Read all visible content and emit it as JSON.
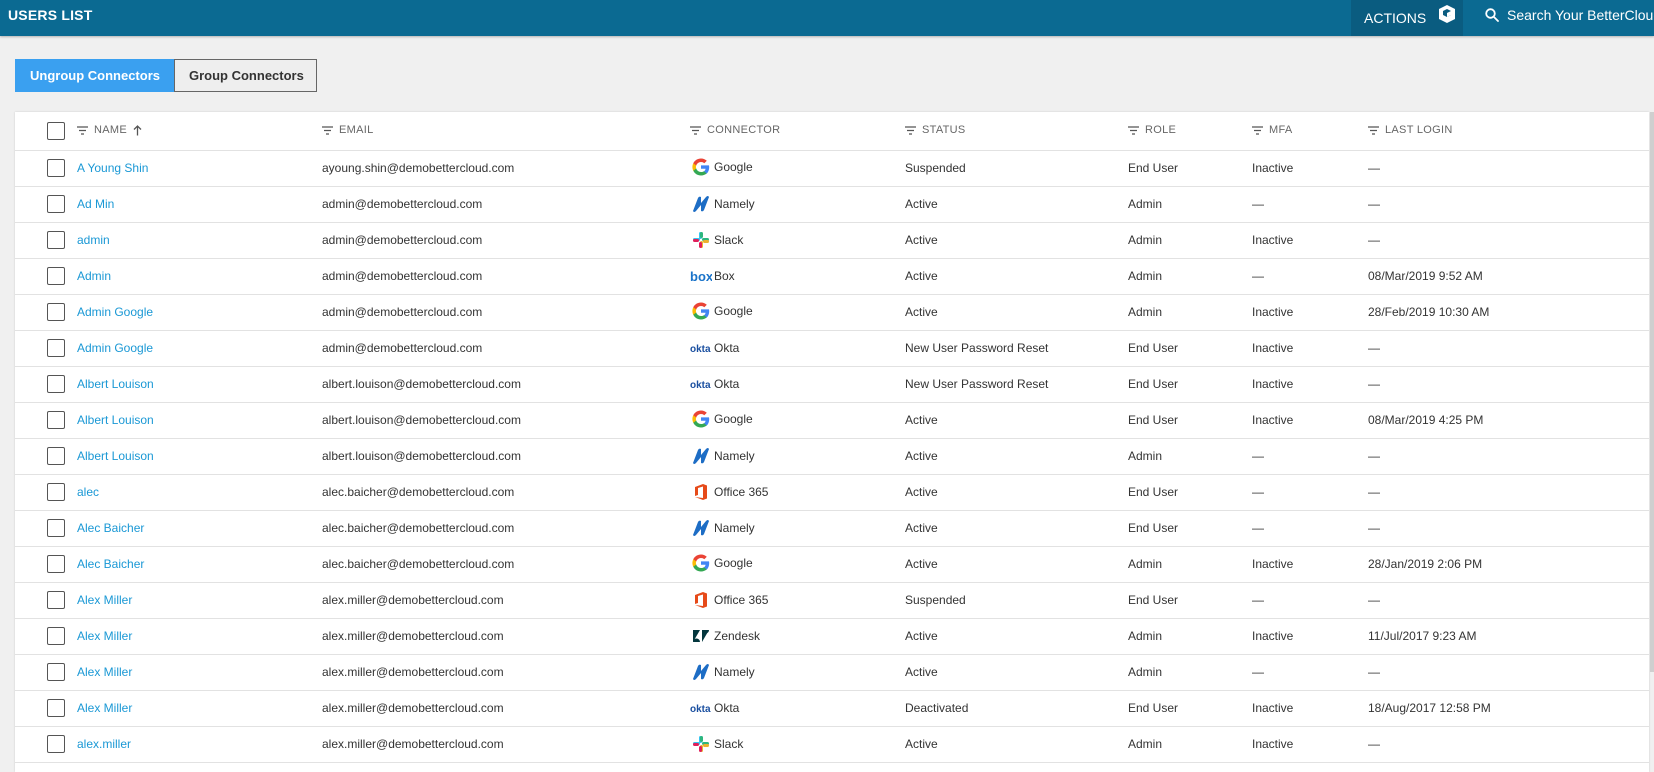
{
  "header": {
    "title": "USERS LIST",
    "actions_label": "ACTIONS",
    "search_placeholder": "Search Your BetterCloud"
  },
  "toggle": {
    "ungroup_label": "Ungroup Connectors",
    "group_label": "Group Connectors"
  },
  "table": {
    "columns": {
      "name": "NAME",
      "email": "EMAIL",
      "connector": "CONNECTOR",
      "status": "STATUS",
      "role": "ROLE",
      "mfa": "MFA",
      "last_login": "LAST LOGIN"
    },
    "rows": [
      {
        "name": "A Young Shin",
        "email": "ayoung.shin@demobettercloud.com",
        "connector": "Google",
        "connector_icon": "google-icon",
        "status": "Suspended",
        "role": "End User",
        "mfa": "Inactive",
        "last_login": "—"
      },
      {
        "name": "Ad Min",
        "email": "admin@demobettercloud.com",
        "connector": "Namely",
        "connector_icon": "namely-icon",
        "status": "Active",
        "role": "Admin",
        "mfa": "—",
        "last_login": "—"
      },
      {
        "name": "admin",
        "email": "admin@demobettercloud.com",
        "connector": "Slack",
        "connector_icon": "slack-icon",
        "status": "Active",
        "role": "Admin",
        "mfa": "Inactive",
        "last_login": "—"
      },
      {
        "name": "Admin",
        "email": "admin@demobettercloud.com",
        "connector": "Box",
        "connector_icon": "box-icon",
        "status": "Active",
        "role": "Admin",
        "mfa": "—",
        "last_login": "08/Mar/2019 9:52 AM"
      },
      {
        "name": "Admin Google",
        "email": "admin@demobettercloud.com",
        "connector": "Google",
        "connector_icon": "google-icon",
        "status": "Active",
        "role": "Admin",
        "mfa": "Inactive",
        "last_login": "28/Feb/2019 10:30 AM"
      },
      {
        "name": "Admin Google",
        "email": "admin@demobettercloud.com",
        "connector": "Okta",
        "connector_icon": "okta-icon",
        "status": "New User Password Reset",
        "role": "End User",
        "mfa": "Inactive",
        "last_login": "—"
      },
      {
        "name": "Albert Louison",
        "email": "albert.louison@demobettercloud.com",
        "connector": "Okta",
        "connector_icon": "okta-icon",
        "status": "New User Password Reset",
        "role": "End User",
        "mfa": "Inactive",
        "last_login": "—"
      },
      {
        "name": "Albert Louison",
        "email": "albert.louison@demobettercloud.com",
        "connector": "Google",
        "connector_icon": "google-icon",
        "status": "Active",
        "role": "End User",
        "mfa": "Inactive",
        "last_login": "08/Mar/2019 4:25 PM"
      },
      {
        "name": "Albert Louison",
        "email": "albert.louison@demobettercloud.com",
        "connector": "Namely",
        "connector_icon": "namely-icon",
        "status": "Active",
        "role": "Admin",
        "mfa": "—",
        "last_login": "—"
      },
      {
        "name": "alec",
        "email": "alec.baicher@demobettercloud.com",
        "connector": "Office 365",
        "connector_icon": "office365-icon",
        "status": "Active",
        "role": "End User",
        "mfa": "—",
        "last_login": "—"
      },
      {
        "name": "Alec Baicher",
        "email": "alec.baicher@demobettercloud.com",
        "connector": "Namely",
        "connector_icon": "namely-icon",
        "status": "Active",
        "role": "End User",
        "mfa": "—",
        "last_login": "—"
      },
      {
        "name": "Alec Baicher",
        "email": "alec.baicher@demobettercloud.com",
        "connector": "Google",
        "connector_icon": "google-icon",
        "status": "Active",
        "role": "Admin",
        "mfa": "Inactive",
        "last_login": "28/Jan/2019 2:06 PM"
      },
      {
        "name": "Alex Miller",
        "email": "alex.miller@demobettercloud.com",
        "connector": "Office 365",
        "connector_icon": "office365-icon",
        "status": "Suspended",
        "role": "End User",
        "mfa": "—",
        "last_login": "—"
      },
      {
        "name": "Alex Miller",
        "email": "alex.miller@demobettercloud.com",
        "connector": "Zendesk",
        "connector_icon": "zendesk-icon",
        "status": "Active",
        "role": "Admin",
        "mfa": "Inactive",
        "last_login": "11/Jul/2017 9:23 AM"
      },
      {
        "name": "Alex Miller",
        "email": "alex.miller@demobettercloud.com",
        "connector": "Namely",
        "connector_icon": "namely-icon",
        "status": "Active",
        "role": "Admin",
        "mfa": "—",
        "last_login": "—"
      },
      {
        "name": "Alex Miller",
        "email": "alex.miller@demobettercloud.com",
        "connector": "Okta",
        "connector_icon": "okta-icon",
        "status": "Deactivated",
        "role": "End User",
        "mfa": "Inactive",
        "last_login": "18/Aug/2017 12:58 PM"
      },
      {
        "name": "alex.miller",
        "email": "alex.miller@demobettercloud.com",
        "connector": "Slack",
        "connector_icon": "slack-icon",
        "status": "Active",
        "role": "Admin",
        "mfa": "Inactive",
        "last_login": "—"
      }
    ]
  }
}
